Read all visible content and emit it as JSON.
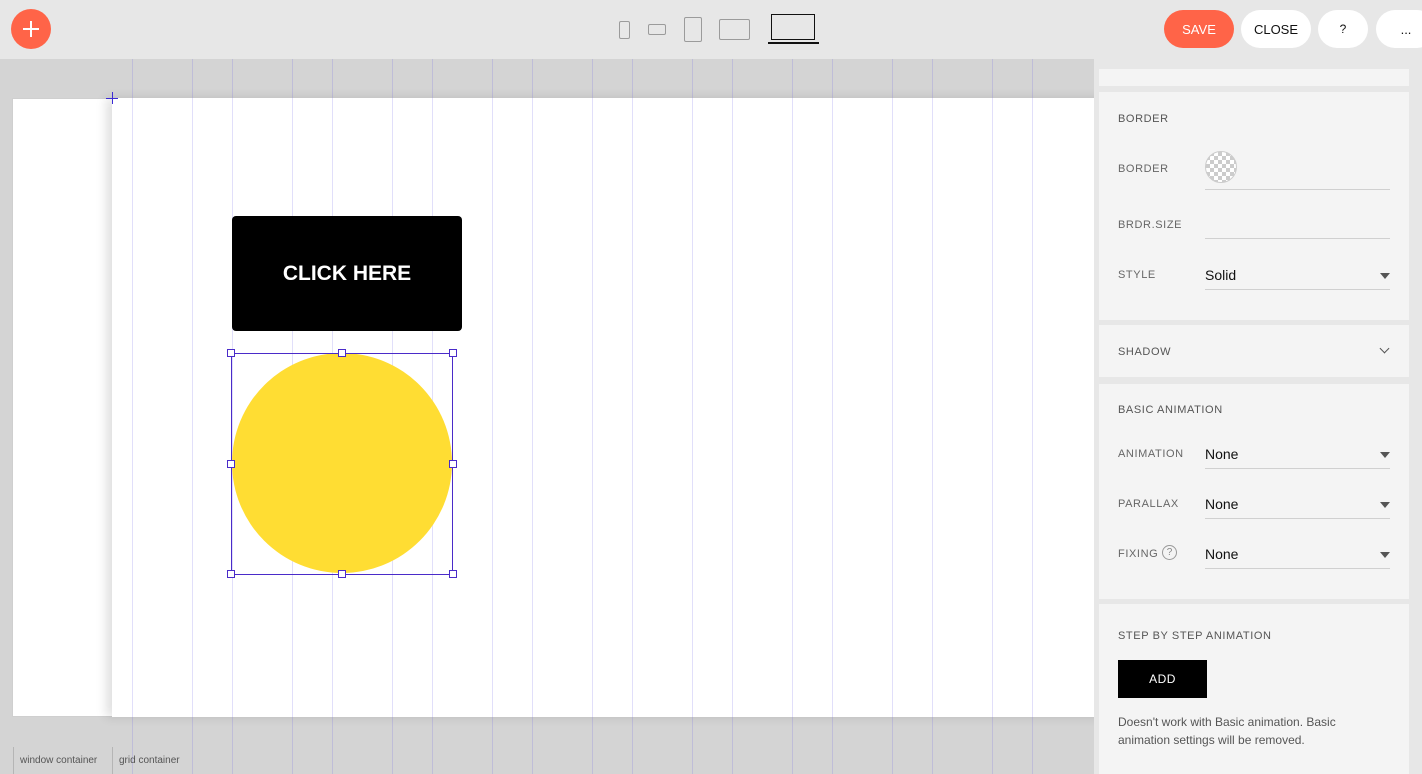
{
  "toolbar": {
    "add_icon": "plus-icon",
    "devices": [
      "phone-portrait-icon",
      "phone-landscape-icon",
      "tablet-portrait-icon",
      "tablet-landscape-icon",
      "desktop-icon"
    ],
    "active_device": "desktop",
    "save_label": "SAVE",
    "close_label": "CLOSE",
    "help_label": "?",
    "more_label": "...",
    "accent_color": "#ff6448"
  },
  "canvas": {
    "cta_button_text": "CLICK HERE",
    "circle_color": "#ffdd33",
    "footer": {
      "window_label": "window container",
      "grid_label": "grid container"
    }
  },
  "panel": {
    "border": {
      "title": "BORDER",
      "border_label": "BORDER",
      "size_label": "BRDR.SIZE",
      "style_label": "STYLE",
      "style_value": "Solid"
    },
    "shadow": {
      "title": "SHADOW"
    },
    "basic_animation": {
      "title": "BASIC ANIMATION",
      "animation_label": "ANIMATION",
      "animation_value": "None",
      "parallax_label": "PARALLAX",
      "parallax_value": "None",
      "fixing_label": "FIXING",
      "fixing_help": "?",
      "fixing_value": "None"
    },
    "step_animation": {
      "title": "STEP BY STEP ANIMATION",
      "add_label": "ADD",
      "note": "Doesn't work with Basic animation. Basic animation settings will be removed."
    }
  }
}
